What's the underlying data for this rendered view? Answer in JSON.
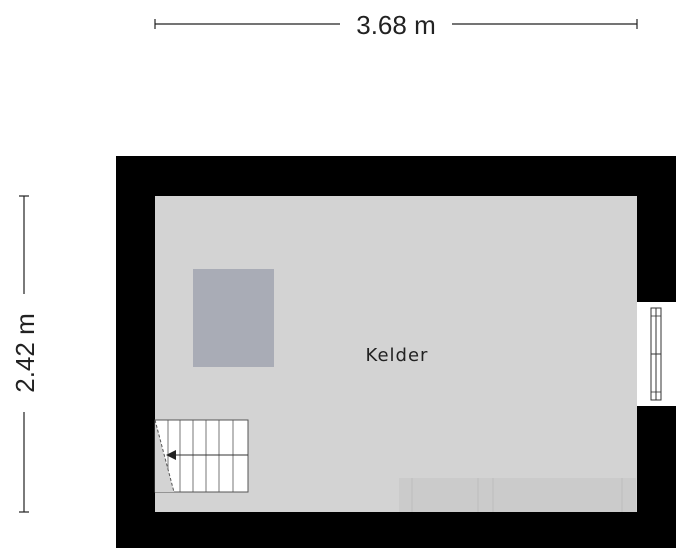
{
  "dimensions": {
    "width_label": "3.68 m",
    "height_label": "2.42 m"
  },
  "room": {
    "name": "Kelder"
  },
  "colors": {
    "wall": "#000000",
    "floor": "#d3d3d3",
    "rug": "#a9acb6",
    "stair_fill": "#ffffff",
    "cabinet": "#cbcbcb",
    "dimension_line": "#222222"
  }
}
